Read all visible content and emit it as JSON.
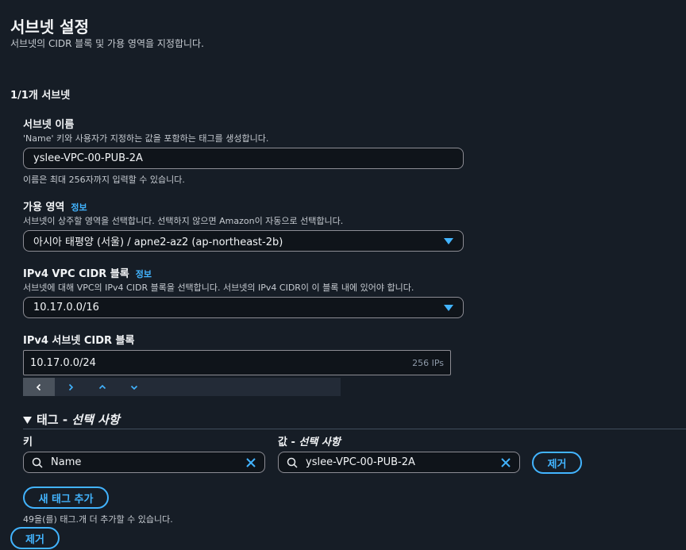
{
  "page": {
    "title": "서브넷 설정",
    "subtitle": "서브넷의 CIDR 블록 및 가용 영역을 지정합니다."
  },
  "subnet_counter": "1/1개 서브넷",
  "subnet_name": {
    "label": "서브넷 이름",
    "description": "'Name' 키와 사용자가 지정하는 값을 포함하는 태그를 생성합니다.",
    "value": "yslee-VPC-00-PUB-2A",
    "hint": "이름은 최대 256자까지 입력할 수 있습니다."
  },
  "availability_zone": {
    "label": "가용 영역",
    "info_link": "정보",
    "description": "서브넷이 상주할 영역을 선택합니다. 선택하지 않으면 Amazon이 자동으로 선택합니다.",
    "selected": "아시아 태평양 (서울) / apne2-az2 (ap-northeast-2b)"
  },
  "vpc_cidr": {
    "label": "IPv4 VPC CIDR 블록",
    "info_link": "정보",
    "description": "서브넷에 대해 VPC의 IPv4 CIDR 블록을 선택합니다. 서브넷의 IPv4 CIDR이 이 블록 내에 있어야 합니다.",
    "selected": "10.17.0.0/16"
  },
  "subnet_cidr": {
    "label": "IPv4 서브넷 CIDR 블록",
    "value": "10.17.0.0/24",
    "ip_count": "256 IPs"
  },
  "tags": {
    "heading": "태그",
    "heading_optional": "선택 사항",
    "key_label": "키",
    "value_label": "값",
    "value_label_optional": "선택 사항",
    "key_value": "Name",
    "value_value": "yslee-VPC-00-PUB-2A",
    "remove_button": "제거",
    "add_button": "새 태그 추가",
    "limit_hint": "49을(를) 태그.개 더 추가할 수 있습니다."
  },
  "remove_subnet_button": "제거",
  "colors": {
    "background": "#161d26",
    "accent": "#42b4ff",
    "input_bg": "#0f141a",
    "border": "#8c8c94"
  }
}
